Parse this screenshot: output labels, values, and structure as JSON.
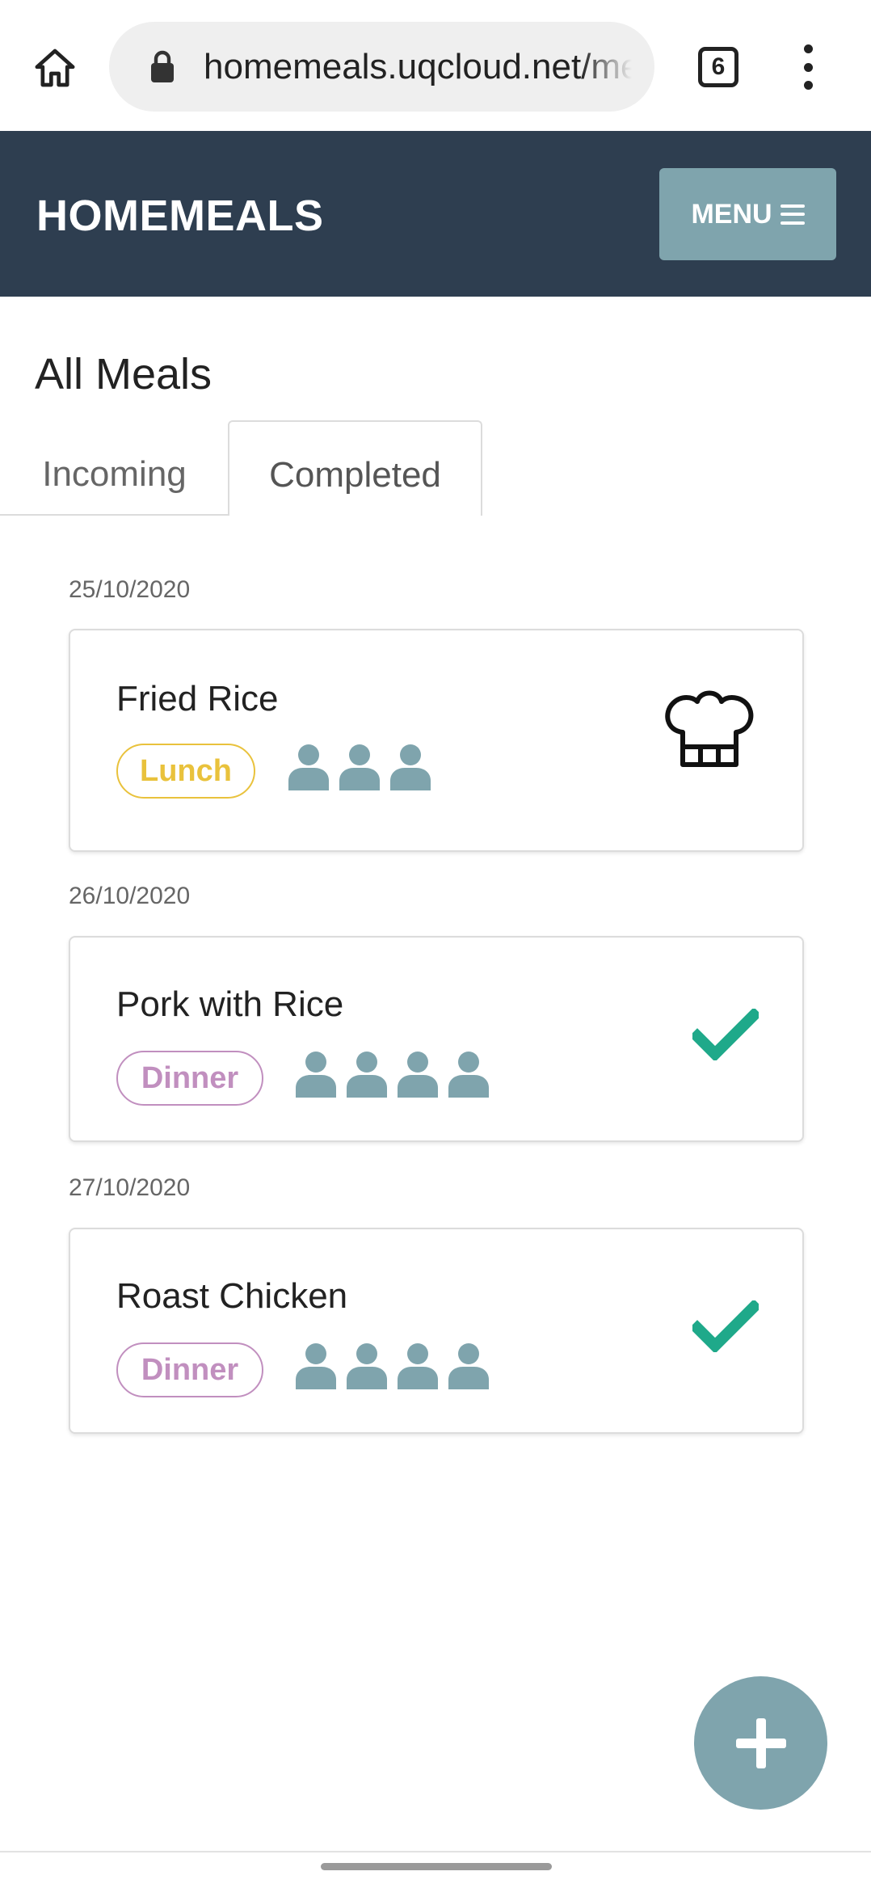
{
  "browser": {
    "url": "homemeals.uqcloud.net/meals",
    "tab_count": "6",
    "icons": [
      "home-icon",
      "lock-icon",
      "more-vert-icon"
    ]
  },
  "header": {
    "brand": "HOMEMEALS",
    "menu_label": "MENU",
    "background_color": "#2e3e50",
    "button_color": "#7fa4ad"
  },
  "page": {
    "title": "All Meals",
    "tabs": [
      {
        "label": "Incoming",
        "active": false
      },
      {
        "label": "Completed",
        "active": true
      }
    ]
  },
  "meals": [
    {
      "date": "25/10/2020",
      "name": "Fried Rice",
      "tag": "Lunch",
      "people": 3,
      "status_icon": "chef-hat-icon"
    },
    {
      "date": "26/10/2020",
      "name": "Pork with Rice",
      "tag": "Dinner",
      "people": 4,
      "status_icon": "check-icon"
    },
    {
      "date": "27/10/2020",
      "name": "Roast Chicken",
      "tag": "Dinner",
      "people": 4,
      "status_icon": "check-icon"
    }
  ],
  "colors": {
    "lunch_tag": "#e9c23c",
    "dinner_tag": "#c18fbf",
    "person_icon": "#7fa4ad",
    "check": "#1fa98a"
  },
  "fab": {
    "icon": "plus-icon"
  }
}
